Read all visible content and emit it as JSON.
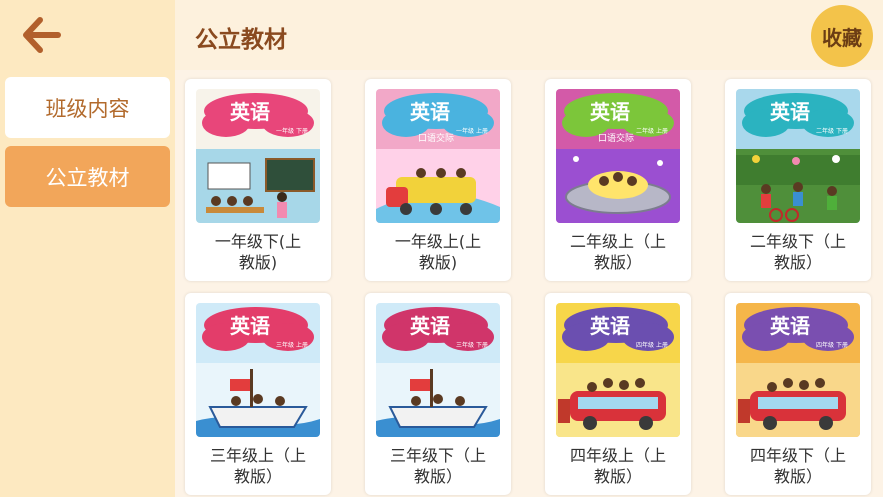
{
  "sidebar": {
    "items": [
      {
        "label": "班级内容"
      },
      {
        "label": "公立教材"
      }
    ]
  },
  "header": {
    "title": "公立教材",
    "favorite_label": "收藏"
  },
  "books": [
    {
      "title": "英语",
      "grade_badge": "一年级 下册",
      "label": "一年级下(上\n教版)"
    },
    {
      "title": "英语",
      "subtitle": "口语交际",
      "grade_badge": "一年级 上册",
      "label": "一年级上(上\n教版)"
    },
    {
      "title": "英语",
      "subtitle": "口语交际",
      "grade_badge": "二年级 上册",
      "label": "二年级上（上\n教版）"
    },
    {
      "title": "英语",
      "grade_badge": "二年级 下册",
      "label": "二年级下（上\n教版）"
    },
    {
      "title": "英语",
      "grade_badge": "三年级 上册",
      "label": "三年级上（上\n教版）"
    },
    {
      "title": "英语",
      "grade_badge": "三年级 下册",
      "label": "三年级下（上\n教版）"
    },
    {
      "title": "英语",
      "grade_badge": "四年级 上册",
      "label": "四年级上（上\n教版）"
    },
    {
      "title": "英语",
      "grade_badge": "四年级 下册",
      "label": "四年级下（上\n教版）"
    }
  ],
  "colors": {
    "sidebar_bg": "#fde9c1",
    "active_item": "#f2a65a",
    "accent_brown": "#b26a2c",
    "favorite_button": "#f3c34a"
  }
}
